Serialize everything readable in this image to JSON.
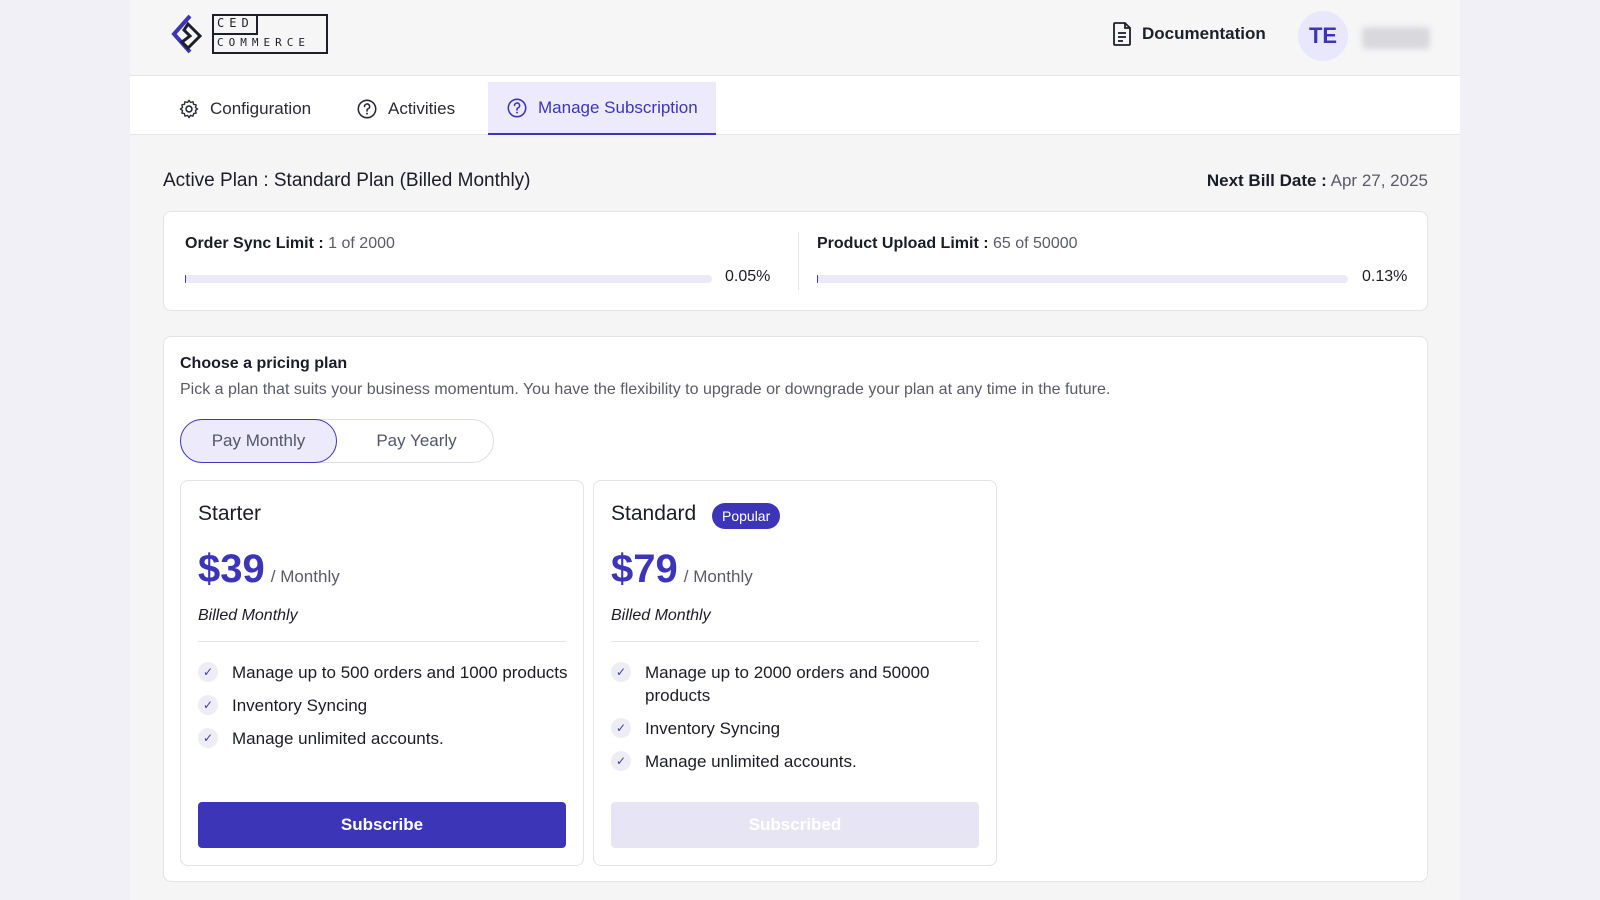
{
  "brand": {
    "logo_top": "CED",
    "logo_bottom": "COMMERCE"
  },
  "header": {
    "documentation_label": "Documentation",
    "avatar_initials": "TE"
  },
  "tabs": [
    {
      "label": "Configuration",
      "icon": "gear-icon"
    },
    {
      "label": "Activities",
      "icon": "question-icon"
    },
    {
      "label": "Manage Subscription",
      "icon": "question-icon",
      "active": true
    }
  ],
  "plan_info": {
    "active_plan": "Active Plan : Standard Plan (Billed Monthly)",
    "next_bill_label": "Next Bill Date :",
    "next_bill_value": "Apr 27, 2025"
  },
  "limits": {
    "order_sync": {
      "label": "Order Sync Limit :",
      "value": "1 of 2000",
      "percent": "0.05%",
      "fraction": 0.0005
    },
    "product_upload": {
      "label": "Product Upload Limit :",
      "value": "65 of 50000",
      "percent": "0.13%",
      "fraction": 0.0013
    }
  },
  "pricing": {
    "title": "Choose a pricing plan",
    "subtitle": "Pick a plan that suits your business momentum. You have the flexibility to upgrade or downgrade your plan at any time in the future.",
    "toggle": {
      "monthly": "Pay Monthly",
      "yearly": "Pay Yearly",
      "selected": "monthly"
    },
    "plans": [
      {
        "name": "Starter",
        "price": "$39",
        "period": "/ Monthly",
        "billing": "Billed Monthly",
        "features": [
          "Manage up to 500 orders and 1000 products",
          "Inventory Syncing",
          "Manage unlimited accounts."
        ],
        "button": "Subscribe"
      },
      {
        "name": "Standard",
        "badge": "Popular",
        "price": "$79",
        "period": "/ Monthly",
        "billing": "Billed Monthly",
        "features": [
          "Manage up to 2000 orders and 50000 products",
          "Inventory Syncing",
          "Manage unlimited accounts."
        ],
        "button": "Subscribed"
      }
    ]
  },
  "colors": {
    "accent": "#3d35b8",
    "accent_light": "#eceafb",
    "disabled_button": "#e7e5f3"
  }
}
